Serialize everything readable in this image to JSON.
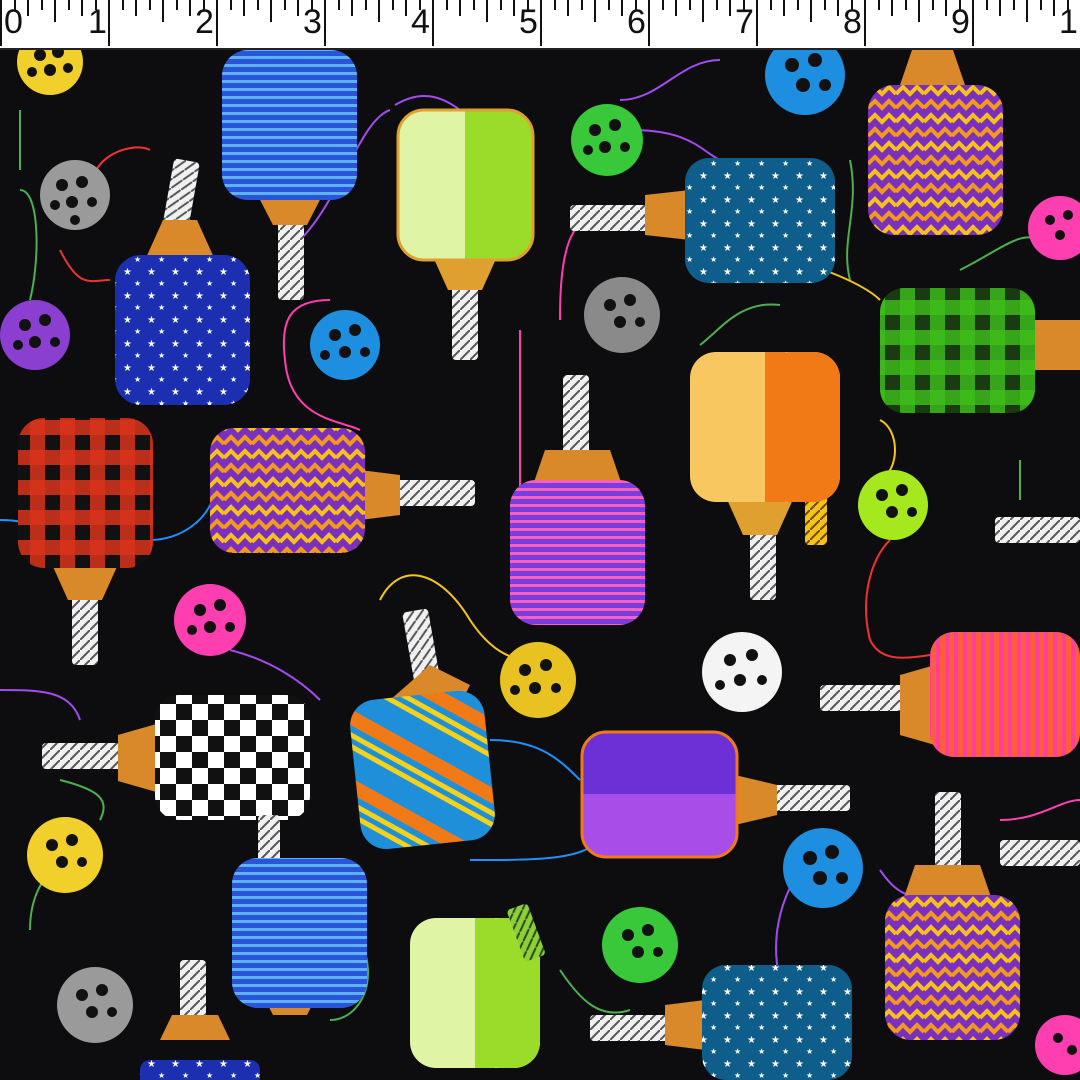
{
  "ruler": {
    "unit_labels": [
      "0",
      "1",
      "2",
      "3",
      "4",
      "5",
      "6",
      "7",
      "8",
      "9",
      "1"
    ],
    "ticks_per_unit": 8
  },
  "fabric": {
    "print": "pickleball paddles and balls",
    "background": "#0d0d0f",
    "cord_colors": [
      "#e33",
      "#a24cf0",
      "#1e90ff",
      "#4caf50",
      "#ff3fb0",
      "#f5c518"
    ],
    "paddles": [
      {
        "name": "paddle-blue-stripes",
        "pattern": "stripes",
        "colors": [
          "#2a55d8",
          "#4fa3ff"
        ]
      },
      {
        "name": "paddle-lime-split",
        "pattern": "split",
        "colors": [
          "#dff5a5",
          "#9bdc2a"
        ]
      },
      {
        "name": "paddle-purple-chevron",
        "pattern": "chevron",
        "colors": [
          "#7b2fbe",
          "#f6c21a"
        ]
      },
      {
        "name": "paddle-navy-stars",
        "pattern": "stars",
        "colors": [
          "#1b2fb0",
          "#ffffff"
        ]
      },
      {
        "name": "paddle-teal-stars",
        "pattern": "stars",
        "colors": [
          "#0f5d8a",
          "#ffffff"
        ]
      },
      {
        "name": "paddle-green-plaid",
        "pattern": "plaid",
        "colors": [
          "#1f6d1a",
          "#4fd41f"
        ]
      },
      {
        "name": "paddle-red-plaid",
        "pattern": "plaid",
        "colors": [
          "#c12a10",
          "#111111"
        ]
      },
      {
        "name": "paddle-chevron-2",
        "pattern": "chevron",
        "colors": [
          "#7b2fbe",
          "#f6c21a"
        ]
      },
      {
        "name": "paddle-pink-violet-stripes",
        "pattern": "stripes",
        "colors": [
          "#7a3ee0",
          "#ff4fa8"
        ]
      },
      {
        "name": "paddle-orange-split",
        "pattern": "split",
        "colors": [
          "#f9c760",
          "#f27a16"
        ]
      },
      {
        "name": "paddle-checker",
        "pattern": "checker",
        "colors": [
          "#ffffff",
          "#111111"
        ]
      },
      {
        "name": "paddle-diagonal",
        "pattern": "diagonal",
        "colors": [
          "#1e8fd8",
          "#f27a16"
        ]
      },
      {
        "name": "paddle-purple-split",
        "pattern": "split",
        "colors": [
          "#6d2fd6",
          "#a84de8"
        ]
      },
      {
        "name": "paddle-pink-orange-stripes",
        "pattern": "stripes",
        "colors": [
          "#ff5e3a",
          "#ff3f9a"
        ]
      }
    ],
    "balls": [
      {
        "name": "ball-yellow",
        "color": "#f2d02b"
      },
      {
        "name": "ball-gray",
        "color": "#9a9a9a"
      },
      {
        "name": "ball-purple",
        "color": "#8b3fd0"
      },
      {
        "name": "ball-blue",
        "color": "#1e8fe0"
      },
      {
        "name": "ball-green",
        "color": "#38c83a"
      },
      {
        "name": "ball-pink",
        "color": "#ff3fb0"
      },
      {
        "name": "ball-lime",
        "color": "#a6e81e"
      },
      {
        "name": "ball-white",
        "color": "#f4f4f4"
      }
    ]
  }
}
